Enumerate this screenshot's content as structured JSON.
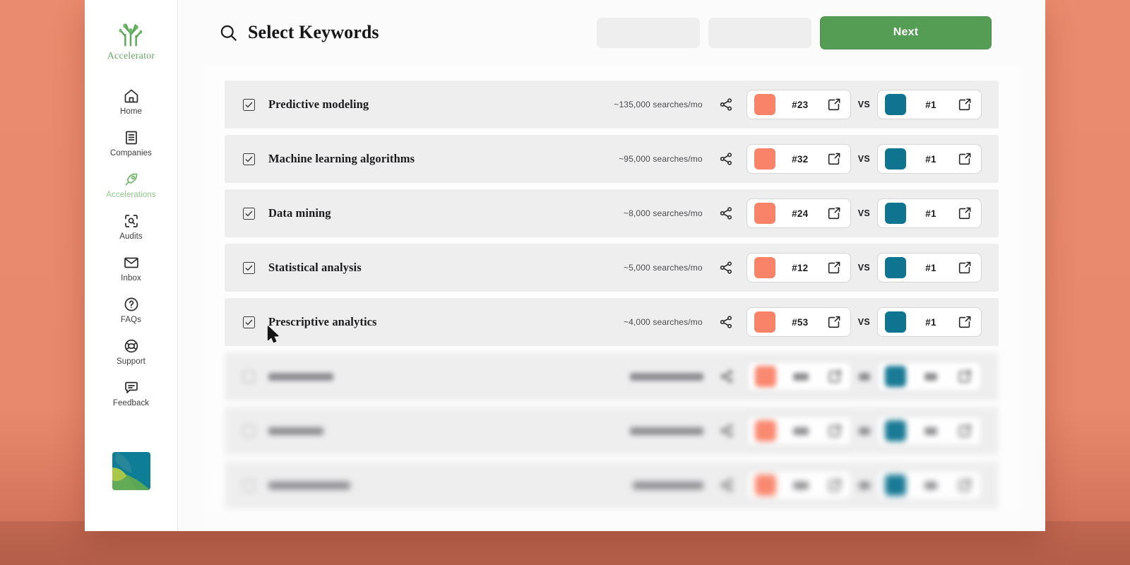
{
  "theme": {
    "background": "#e8886c",
    "panel": "#ffffff",
    "accent_green": "#559c55",
    "brand_green": "#6aa765",
    "row_bg": "#eeeeef",
    "swatch_coral": "#f98369",
    "swatch_teal": "#0f7490"
  },
  "sidebar": {
    "brand": {
      "name": "Accelerator",
      "logo_icon": "tree-logo-icon"
    },
    "items": [
      {
        "label": "Home",
        "icon": "home-icon",
        "active": false
      },
      {
        "label": "Companies",
        "icon": "building-icon",
        "active": false
      },
      {
        "label": "Accelerations",
        "icon": "rocket-icon",
        "active": true
      },
      {
        "label": "Audits",
        "icon": "audit-scan-icon",
        "active": false
      },
      {
        "label": "Inbox",
        "icon": "envelope-icon",
        "active": false
      },
      {
        "label": "FAQs",
        "icon": "question-circle-icon",
        "active": false
      },
      {
        "label": "Support",
        "icon": "lifebuoy-icon",
        "active": false
      },
      {
        "label": "Feedback",
        "icon": "chat-bubble-icon",
        "active": false
      }
    ],
    "footer_logo_icon": "company-square-logo-icon"
  },
  "header": {
    "title": "Select Keywords",
    "search_icon": "search-icon",
    "next_label": "Next",
    "placeholder_boxes": 2
  },
  "keywords": {
    "vs_label": "VS",
    "share_icon": "share-nodes-icon",
    "external_icon": "external-link-icon",
    "rows": [
      {
        "name": "Predictive modeling",
        "checked": true,
        "volume": "~135,000 searches/mo",
        "you": {
          "rank": "#23",
          "color": "#f98369"
        },
        "competitor": {
          "rank": "#1",
          "color": "#0f7490"
        }
      },
      {
        "name": "Machine learning algorithms",
        "checked": true,
        "volume": "~95,000 searches/mo",
        "you": {
          "rank": "#32",
          "color": "#f98369"
        },
        "competitor": {
          "rank": "#1",
          "color": "#0f7490"
        }
      },
      {
        "name": "Data mining",
        "checked": true,
        "volume": "~8,000 searches/mo",
        "you": {
          "rank": "#24",
          "color": "#f98369"
        },
        "competitor": {
          "rank": "#1",
          "color": "#0f7490"
        }
      },
      {
        "name": "Statistical analysis",
        "checked": true,
        "volume": "~5,000 searches/mo",
        "you": {
          "rank": "#12",
          "color": "#f98369"
        },
        "competitor": {
          "rank": "#1",
          "color": "#0f7490"
        }
      },
      {
        "name": "Prescriptive analytics",
        "checked": true,
        "volume": "~4,000 searches/mo",
        "you": {
          "rank": "#53",
          "color": "#f98369"
        },
        "competitor": {
          "rank": "#1",
          "color": "#0f7490"
        }
      }
    ],
    "blurred_rows": 3
  },
  "cursor": {
    "icon": "mouse-pointer-icon"
  }
}
